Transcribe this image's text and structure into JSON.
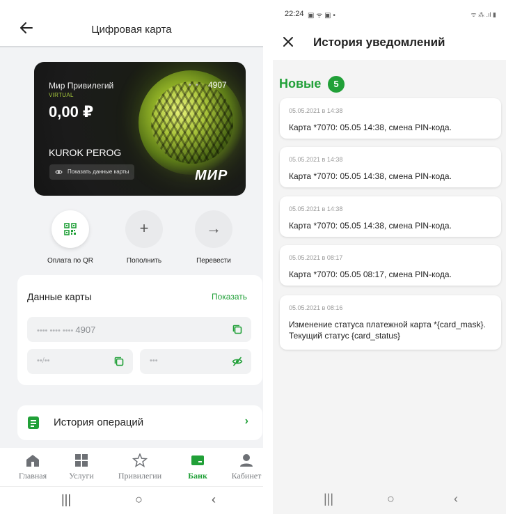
{
  "left": {
    "header": {
      "title": "Цифровая карта"
    },
    "card": {
      "name": "Мир Привилегий",
      "virtual": "VIRTUAL",
      "balance": "0,00 ₽",
      "mask_dots": "• •",
      "last4": "4907",
      "holder": "KUROK PEROG",
      "show_data": "Показать данные карты",
      "brand": "МИР"
    },
    "actions": [
      {
        "label": "Оплата по QR",
        "icon": "qr-code-icon"
      },
      {
        "label": "Пополнить",
        "icon": "plus-icon",
        "symbol": "+"
      },
      {
        "label": "Перевести",
        "icon": "arrow-right-icon",
        "symbol": "→"
      }
    ],
    "card_data": {
      "title": "Данные карты",
      "show": "Показать",
      "number_mask": "•••• •••• ••••",
      "number_last4": "4907",
      "expiry_mask": "••/••",
      "cvv_mask": "•••"
    },
    "history": {
      "label": "История операций",
      "arrow": "›"
    },
    "tabs": [
      {
        "label": "Главная",
        "icon": "home-icon"
      },
      {
        "label": "Услуги",
        "icon": "grid-icon"
      },
      {
        "label": "Привилегии",
        "icon": "star-icon"
      },
      {
        "label": "Банк",
        "icon": "card-icon",
        "active": true
      },
      {
        "label": "Кабинет",
        "icon": "person-icon"
      }
    ],
    "sysnav": {
      "recent": "|||",
      "home": "○",
      "back": "‹"
    },
    "colors": {
      "accent": "#21a038",
      "background": "#f2f3f5"
    }
  },
  "right": {
    "status": {
      "time": "22:24",
      "icons": "▣ ᯤ ▣ •",
      "right": "ᯤ ⁂ .ıl ▮"
    },
    "header": {
      "title": "История уведомлений"
    },
    "section": {
      "label": "Новые",
      "count": "5"
    },
    "notifications": [
      {
        "date": "05.05.2021 в 14:38",
        "text": "Карта *7070: 05.05 14:38, смена PIN-кода."
      },
      {
        "date": "05.05.2021 в 14:38",
        "text": "Карта *7070: 05.05 14:38, смена PIN-кода."
      },
      {
        "date": "05.05.2021 в 14:38",
        "text": "Карта *7070: 05.05 14:38, смена PIN-кода."
      },
      {
        "date": "05.05.2021 в 08:17",
        "text": "Карта *7070: 05.05 08:17, смена PIN-кода."
      },
      {
        "date": "05.05.2021 в 08:16",
        "text": "Изменение статуса платежной карта *{card_mask}. Текущий статус {card_status}"
      }
    ],
    "sysnav": {
      "recent": "|||",
      "home": "○",
      "back": "‹"
    }
  }
}
